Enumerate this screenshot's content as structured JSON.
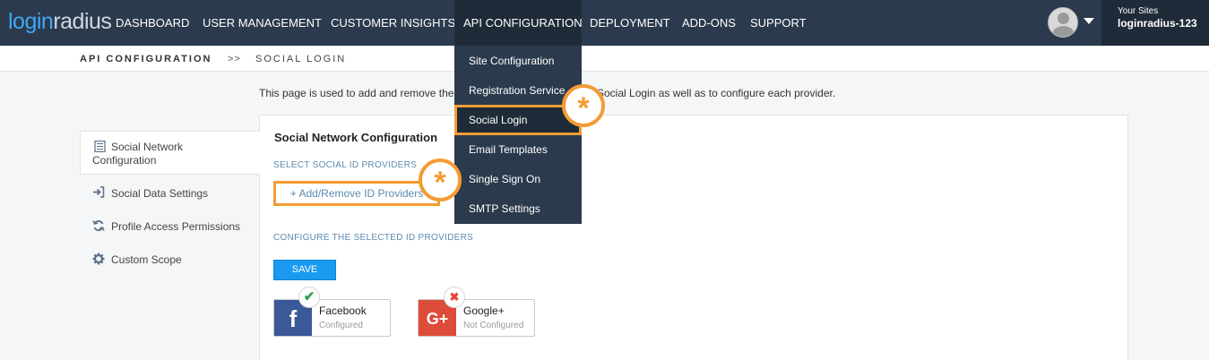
{
  "logo": {
    "part1": "login",
    "part2": "radius"
  },
  "nav": {
    "items": [
      "DASHBOARD",
      "USER MANAGEMENT",
      "CUSTOMER INSIGHTS",
      "API CONFIGURATION",
      "DEPLOYMENT",
      "ADD-ONS",
      "SUPPORT"
    ],
    "active": "API CONFIGURATION"
  },
  "account": {
    "your_sites_label": "Your Sites",
    "site_name": "loginradius-123",
    "avatar_icon": "user-avatar-icon"
  },
  "breadcrumb": {
    "section": "API CONFIGURATION",
    "separator": ">>",
    "page": "SOCIAL LOGIN"
  },
  "intro_text": "This page is used to add and remove the",
  "intro_text_tail": "Social Login as well as to configure each provider.",
  "sidebar": {
    "items": [
      {
        "label_line1": "Social Network",
        "label_line2": "Configuration",
        "icon": "list-icon",
        "active": true
      },
      {
        "label": "Social Data Settings",
        "icon": "sign-in-icon"
      },
      {
        "label": "Profile Access Permissions",
        "icon": "refresh-icon"
      },
      {
        "label": "Custom Scope",
        "icon": "gear-icon"
      }
    ]
  },
  "main": {
    "title": "Social Network Configuration",
    "select_label": "SELECT SOCIAL ID PROVIDERS",
    "add_button": "+ Add/Remove ID Providers",
    "configure_label": "CONFIGURE THE SELECTED ID PROVIDERS",
    "save_button": "SAVE",
    "providers": [
      {
        "name": "Facebook",
        "status": "Configured",
        "glyph": "f",
        "color": "#3b5998",
        "badge": "✔",
        "badge_color": "#2e9e4f"
      },
      {
        "name": "Google+",
        "status": "Not Configured",
        "glyph": "G+",
        "color": "#dd4b39",
        "badge": "✖",
        "badge_color": "#e2473b"
      }
    ]
  },
  "dropdown": {
    "items": [
      "Site Configuration",
      "Registration Service",
      "Social Login",
      "Email Templates",
      "Single Sign On",
      "SMTP Settings"
    ],
    "selected": "Social Login"
  },
  "markers": {
    "symbol": "*",
    "color": "#f39c33"
  },
  "colors": {
    "nav_bg": "#2b3a4c",
    "nav_active": "#1f2b38",
    "accent": "#f39c33",
    "save_blue": "#1a9af0"
  }
}
